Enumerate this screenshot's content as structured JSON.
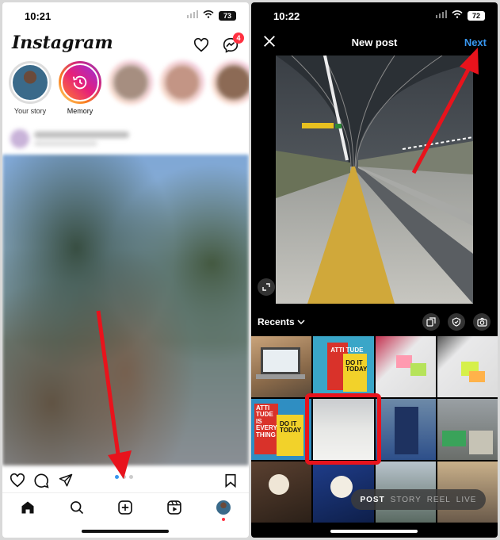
{
  "left": {
    "status": {
      "time": "10:21",
      "battery": "73"
    },
    "header": {
      "logo": "Instagram",
      "notif_count": "4"
    },
    "stories": [
      {
        "label": "Your story"
      },
      {
        "label": "Memory"
      }
    ]
  },
  "right": {
    "status": {
      "time": "10:22",
      "battery": "72"
    },
    "header": {
      "title": "New post",
      "next_label": "Next"
    },
    "gallery": {
      "album_label": "Recents"
    },
    "tiles": [
      {
        "text": "ATTI TUDE",
        "text2": "DO IT TODAY"
      },
      {
        "text": "ATTI TUDE IS EVERY THING",
        "text2": "DO IT TODAY"
      }
    ],
    "modes": [
      "POST",
      "STORY",
      "REEL",
      "LIVE"
    ]
  },
  "colors": {
    "accent_blue": "#3897f0",
    "annotation_red": "#e8131c",
    "badge_red": "#ff3040"
  }
}
